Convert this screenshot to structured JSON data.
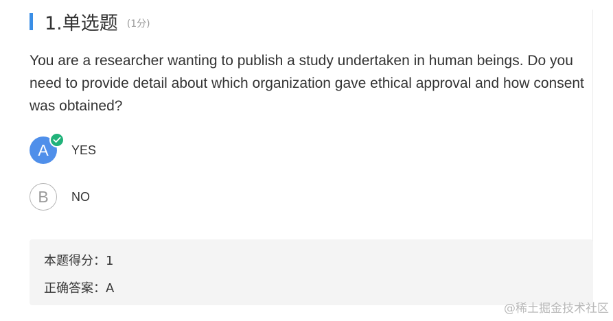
{
  "question": {
    "title": "1.单选题",
    "score": "(1分)",
    "text": "You are a researcher wanting to publish a study undertaken in human beings. Do you need to provide detail about which organization gave ethical approval and how consent was obtained?"
  },
  "options": [
    {
      "letter": "A",
      "label": "YES",
      "selected": true
    },
    {
      "letter": "B",
      "label": "NO",
      "selected": false
    }
  ],
  "result": {
    "score_line": "本题得分：1",
    "answer_line": "正确答案：A"
  },
  "watermark": "@稀土掘金技术社区",
  "colors": {
    "accent": "#3a8ee6",
    "selected_option": "#4f8fea",
    "correct_check": "#21b27a",
    "panel_bg": "#f4f4f4"
  }
}
